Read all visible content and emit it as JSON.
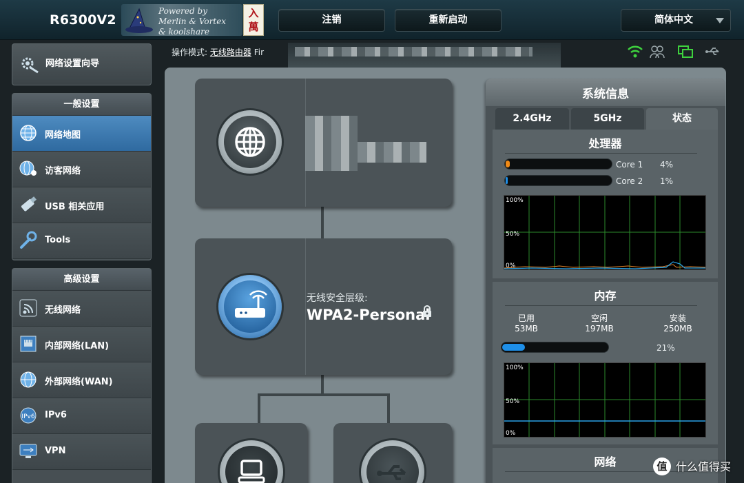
{
  "header": {
    "model": "R6300V2",
    "powered_by": [
      "Powered by",
      "Merlin & Vortex",
      "& koolshare"
    ],
    "seal_chars": "入萬",
    "logout": "注销",
    "reboot": "重新启动",
    "language": "简体中文"
  },
  "sidebar": {
    "wizard": "网络设置向导",
    "general_title": "一般设置",
    "general": [
      {
        "label": "网络地图",
        "icon": "globe-network-icon",
        "active": true
      },
      {
        "label": "访客网络",
        "icon": "guest-network-icon"
      },
      {
        "label": "USB 相关应用",
        "icon": "usb-icon"
      },
      {
        "label": "Tools",
        "icon": "wrench-icon"
      }
    ],
    "advanced_title": "高级设置",
    "advanced": [
      {
        "label": "无线网络",
        "icon": "wireless-icon"
      },
      {
        "label": "内部网络(LAN)",
        "icon": "lan-icon"
      },
      {
        "label": "外部网络(WAN)",
        "icon": "wan-globe-icon"
      },
      {
        "label": "IPv6",
        "icon": "ipv6-icon"
      },
      {
        "label": "VPN",
        "icon": "vpn-icon"
      }
    ]
  },
  "status": {
    "mode_label": "操作模式:",
    "mode_value": "无线路由器",
    "firmware_prefix": "Fir"
  },
  "map": {
    "security_level_label": "无线安全层级:",
    "security_value": "WPA2-Personal"
  },
  "sysinfo": {
    "title": "系统信息",
    "tabs": [
      "2.4GHz",
      "5GHz",
      "状态"
    ],
    "cpu_title": "处理器",
    "cores": [
      {
        "name": "Core 1",
        "percent": "4%",
        "value": 4
      },
      {
        "name": "Core 2",
        "percent": "1%",
        "value": 1
      }
    ],
    "graph_labels": [
      "100%",
      "50%",
      "0%"
    ],
    "mem_title": "内存",
    "mem_headers": [
      "已用",
      "空闲",
      "安装"
    ],
    "mem_values": [
      "53MB",
      "197MB",
      "250MB"
    ],
    "mem_percent": "21%",
    "mem_value": 21,
    "net_title": "网络"
  },
  "watermark": "什么值得买",
  "colors": {
    "accent": "#2f6aa0",
    "cpu_fill": "#f08a16",
    "mem_fill": "#1e8fe8",
    "graph_grid": "#2b8a2b"
  }
}
